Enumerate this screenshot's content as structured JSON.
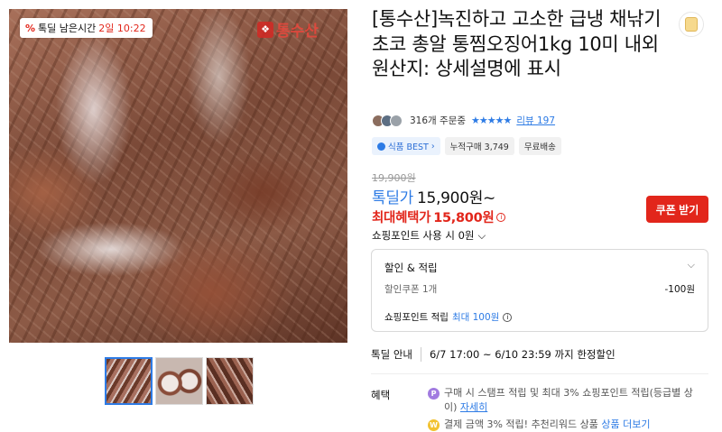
{
  "gallery": {
    "deal_timer": {
      "badge": "%",
      "label": "톡딜 남은시간",
      "time": "2일 10:22"
    },
    "watermark": "통수산",
    "thumbnails": [
      "thumb-1",
      "thumb-2",
      "thumb-3"
    ]
  },
  "product": {
    "title": "[통수산]녹진하고 고소한 급냉 채낚기 초코 총알 통찜오징어1kg 10미 내외 원산지: 상세설명에 표시",
    "order_count": "316개 주문중",
    "stars": "★★★★★",
    "review_label": "리뷰 197",
    "badges": {
      "best": "식품 BEST",
      "cumulative": "누적구매 3,749",
      "shipping": "무료배송"
    }
  },
  "price": {
    "original": "19,900원",
    "deal_label": "톡딜가",
    "deal_value": "15,900원~",
    "max_benefit_label": "최대혜택가",
    "max_benefit_value": "15,800원",
    "coupon_button": "쿠폰 받기",
    "point_toggle": "쇼핑포인트 사용 시 0원"
  },
  "discount_box": {
    "heading": "할인 & 적립",
    "coupon_label": "할인쿠폰 1개",
    "coupon_value": "-100원",
    "point_prefix": "쇼핑포인트 적립",
    "point_value": "최대 100원"
  },
  "deal_notice": {
    "label": "톡딜 안내",
    "value": "6/7 17:00 ~ 6/10 23:59 까지 한정할인"
  },
  "benefits": {
    "label": "혜택",
    "item1_text": "구매 시 스탬프 적립 및 최대 3% 쇼핑포인트 적립(등급별 상이)",
    "item1_link": "자세히",
    "item2_text": "결제 금액 3% 적립! 추천리워드 상품",
    "item2_link": "상품 더보기"
  },
  "colors": {
    "accent_blue": "#2d7be5",
    "accent_red": "#e2261b"
  }
}
